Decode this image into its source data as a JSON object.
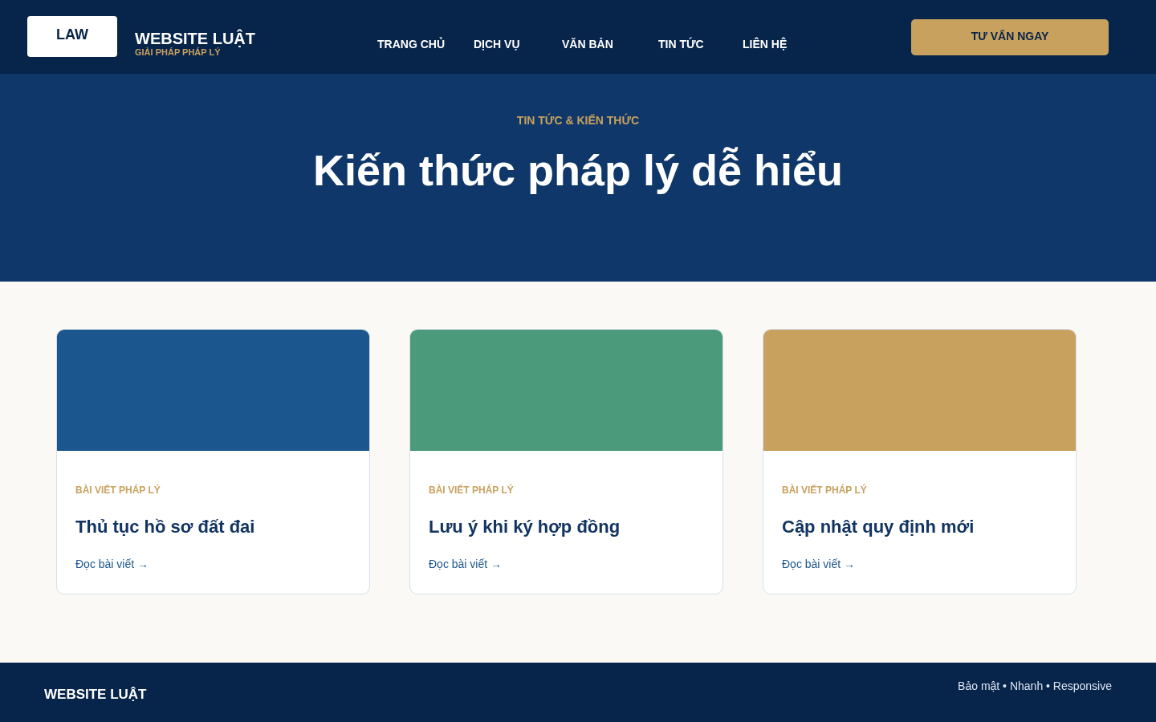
{
  "header": {
    "logo": "LAW",
    "brand": "WEBSITE LUẬT",
    "tagline": "GIẢI PHÁP PHÁP LÝ",
    "nav": [
      {
        "label": "TRANG CHỦ"
      },
      {
        "label": "DỊCH VỤ"
      },
      {
        "label": "VĂN BẢN"
      },
      {
        "label": "TIN TỨC"
      },
      {
        "label": "LIÊN HỆ"
      }
    ],
    "cta": "TƯ VẤN NGAY"
  },
  "hero": {
    "eyebrow": "TIN TỨC & KIẾN THỨC",
    "title": "Kiến thức pháp lý dễ hiểu"
  },
  "cards": [
    {
      "color": "#1c568e",
      "category": "BÀI VIẾT PHÁP LÝ",
      "title": "Thủ tục hồ sơ đất đai",
      "link": "Đọc bài viết →"
    },
    {
      "color": "#4b9a7c",
      "category": "BÀI VIẾT PHÁP LÝ",
      "title": "Lưu ý khi ký hợp đồng",
      "link": "Đọc bài viết →"
    },
    {
      "color": "#c8a15e",
      "category": "BÀI VIẾT PHÁP LÝ",
      "title": "Cập nhật quy định mới",
      "link": "Đọc bài viết →"
    }
  ],
  "footer": {
    "brand": "WEBSITE LUẬT",
    "features": "Bảo mật • Nhanh • Responsive"
  }
}
